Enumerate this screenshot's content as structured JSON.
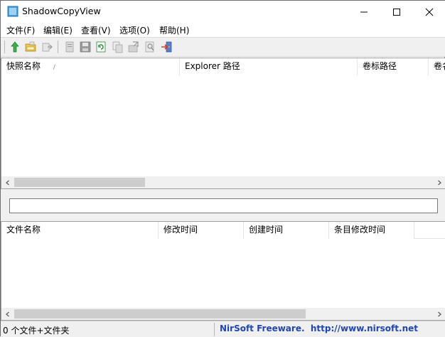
{
  "app": {
    "title": "ShadowCopyView"
  },
  "menu": [
    "文件(F)",
    "编辑(E)",
    "查看(V)",
    "选项(O)",
    "帮助(H)"
  ],
  "top_list": {
    "columns": [
      "快照名称",
      "Explorer 路径",
      "卷标路径",
      "卷名"
    ],
    "sort_indicator": "/"
  },
  "path_field": {
    "value": ""
  },
  "bottom_list": {
    "columns": [
      "文件名称",
      "修改时间",
      "创建时间",
      "条目修改时间"
    ]
  },
  "status": {
    "count_text": "0 个文件+文件夹",
    "link_text": "NirSoft Freeware.  http://www.nirsoft.net"
  },
  "toolbar_icons": [
    "up-arrow-icon",
    "open-folder-icon",
    "export-icon",
    "copy-file-icon",
    "save-icon",
    "refresh-icon",
    "copy-icon",
    "properties-icon",
    "find-icon",
    "exit-icon"
  ]
}
